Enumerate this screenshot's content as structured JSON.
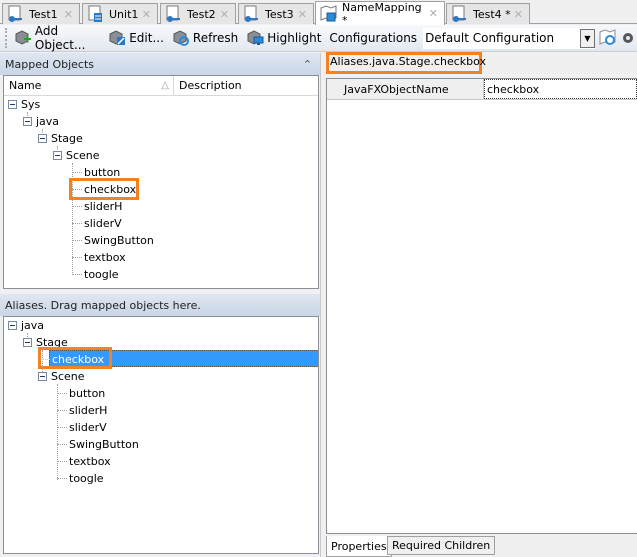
{
  "tabs": [
    {
      "label": "Test1",
      "icon": "test-key-icon",
      "active": false
    },
    {
      "label": "Unit1",
      "icon": "unit-doc-icon",
      "active": false
    },
    {
      "label": "Test2",
      "icon": "test-key-icon",
      "active": false
    },
    {
      "label": "Test3",
      "icon": "test-key-icon",
      "active": false
    },
    {
      "label": "NameMapping *",
      "icon": "namemapping-icon",
      "active": true
    },
    {
      "label": "Test4 *",
      "icon": "test-key-icon",
      "active": false
    }
  ],
  "tab_close": "✕",
  "toolbar": {
    "add_object": "Add Object...",
    "edit": "Edit...",
    "refresh": "Refresh",
    "highlight": "Highlight",
    "configurations_label": "Configurations",
    "configuration_value": "Default Configuration",
    "dropdown_arrow": "▼"
  },
  "mapped_objects": {
    "title": "Mapped Objects",
    "collapse_glyph": "⌃",
    "col_name": "Name",
    "col_sort": "△",
    "col_description": "Description",
    "tree": {
      "sys": "Sys",
      "java": "java",
      "stage": "Stage",
      "scene": "Scene",
      "children": [
        "button",
        "checkbox",
        "sliderH",
        "sliderV",
        "SwingButton",
        "textbox",
        "toogle"
      ]
    }
  },
  "aliases": {
    "title": "Aliases. Drag mapped objects here.",
    "tree": {
      "java": "java",
      "stage": "Stage",
      "selected": "checkbox",
      "scene": "Scene",
      "children": [
        "button",
        "sliderH",
        "sliderV",
        "SwingButton",
        "textbox",
        "toogle"
      ]
    }
  },
  "properties": {
    "path": "Aliases.java.Stage.checkbox",
    "rows": [
      {
        "name": "JavaFXObjectName",
        "value": "checkbox"
      }
    ]
  },
  "bottom_tabs": {
    "properties": "Properties",
    "required_children": "Required Children"
  },
  "colors": {
    "highlight_border": "#f58220",
    "selection": "#3399ff"
  }
}
